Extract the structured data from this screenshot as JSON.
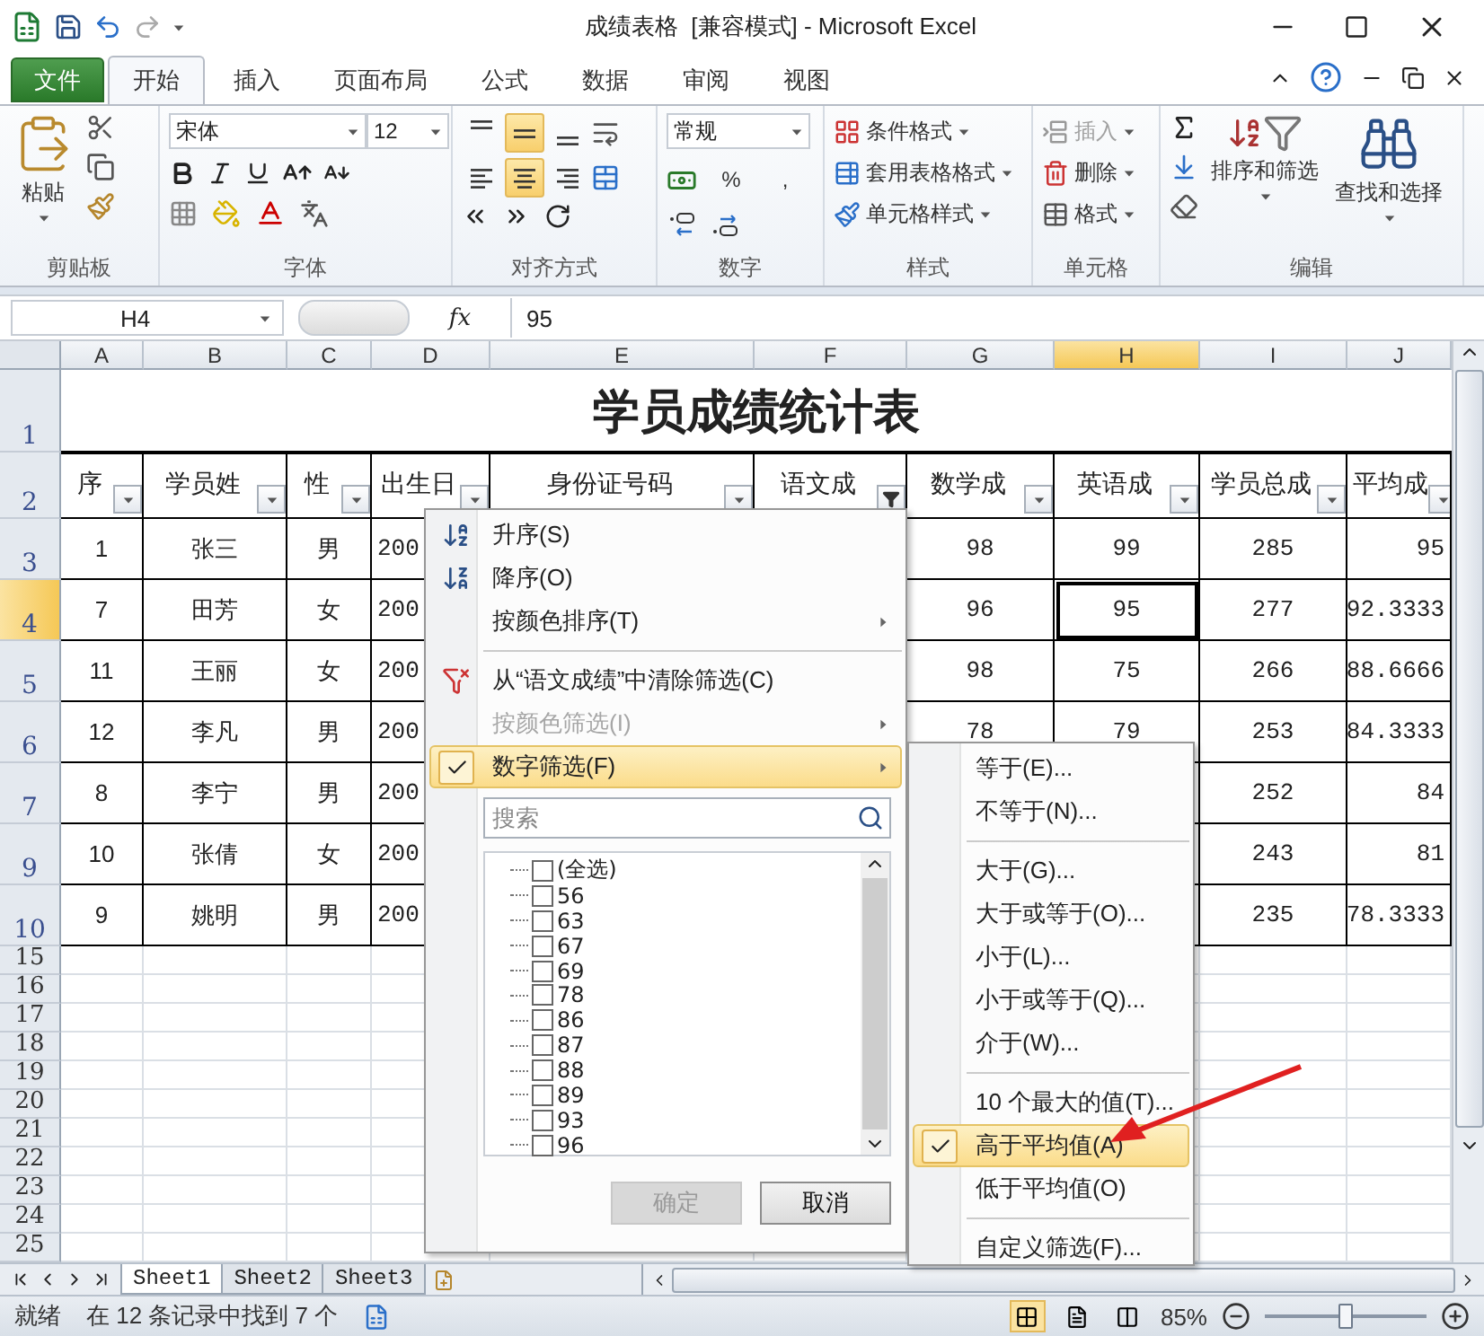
{
  "window": {
    "title": "成绩表格  [兼容模式] - Microsoft Excel"
  },
  "ribbon_tabs": [
    {
      "label": "文件",
      "kind": "file",
      "selected": false
    },
    {
      "label": "开始",
      "kind": "tab",
      "selected": true
    },
    {
      "label": "插入",
      "kind": "tab",
      "selected": false
    },
    {
      "label": "页面布局",
      "kind": "tab",
      "selected": false
    },
    {
      "label": "公式",
      "kind": "tab",
      "selected": false
    },
    {
      "label": "数据",
      "kind": "tab",
      "selected": false
    },
    {
      "label": "审阅",
      "kind": "tab",
      "selected": false
    },
    {
      "label": "视图",
      "kind": "tab",
      "selected": false
    }
  ],
  "ribbon": {
    "paste": "粘贴",
    "font_name": "宋体",
    "font_size": "12",
    "alignment_buttons": [
      {
        "kind": "top",
        "selected": false
      },
      {
        "kind": "middle",
        "selected": true
      },
      {
        "kind": "bottom",
        "selected": false
      },
      {
        "kind": "left",
        "selected": false
      },
      {
        "kind": "center",
        "selected": true
      },
      {
        "kind": "right",
        "selected": false
      }
    ],
    "number_format": "常规",
    "percent": "%",
    "comma": ",",
    "styles": [
      "条件格式",
      "套用表格格式",
      "单元格样式"
    ],
    "cells": [
      {
        "label": "插入",
        "disabled": true
      },
      {
        "label": "删除",
        "disabled": false
      },
      {
        "label": "格式",
        "disabled": false
      }
    ],
    "sort_filter": "排序和筛选",
    "find_select": "查找和选择",
    "groups": [
      "剪贴板",
      "字体",
      "对齐方式",
      "数字",
      "样式",
      "单元格",
      "编辑"
    ]
  },
  "formula_bar": {
    "name_box": "H4",
    "fx": "fx",
    "value": "95"
  },
  "sheet": {
    "columns": [
      {
        "label": "A",
        "selected": false
      },
      {
        "label": "B",
        "selected": false
      },
      {
        "label": "C",
        "selected": false
      },
      {
        "label": "D",
        "selected": false
      },
      {
        "label": "E",
        "selected": false
      },
      {
        "label": "F",
        "selected": false
      },
      {
        "label": "G",
        "selected": false
      },
      {
        "label": "H",
        "selected": true
      },
      {
        "label": "I",
        "selected": false
      },
      {
        "label": "J",
        "selected": false
      }
    ],
    "title_row": "1",
    "title": "学员成绩统计表",
    "header_row": "2",
    "headers": [
      {
        "text": "序",
        "filtered": false
      },
      {
        "text": "学员姓",
        "filtered": false
      },
      {
        "text": "性",
        "filtered": false
      },
      {
        "text": "出生日",
        "filtered": false
      },
      {
        "text": "身份证号码",
        "filtered": false
      },
      {
        "text": "语文成",
        "filtered": true
      },
      {
        "text": "数学成",
        "filtered": false
      },
      {
        "text": "英语成",
        "filtered": false
      },
      {
        "text": "学员总成",
        "filtered": false
      },
      {
        "text": "平均成",
        "filtered": false
      }
    ],
    "rows": [
      {
        "header": "3",
        "selected": false,
        "a": "1",
        "b": "张三",
        "c": "男",
        "d": "200",
        "g": "98",
        "h": "99",
        "i": "285",
        "j": "95"
      },
      {
        "header": "4",
        "selected": true,
        "a": "7",
        "b": "田芳",
        "c": "女",
        "d": "200",
        "g": "96",
        "h": "95",
        "i": "277",
        "j": "92.3333"
      },
      {
        "header": "5",
        "selected": false,
        "a": "11",
        "b": "王丽",
        "c": "女",
        "d": "200",
        "g": "98",
        "h": "75",
        "i": "266",
        "j": "88.6666"
      },
      {
        "header": "6",
        "selected": false,
        "a": "12",
        "b": "李凡",
        "c": "男",
        "d": "200",
        "g": "78",
        "h": "79",
        "i": "253",
        "j": "84.3333"
      },
      {
        "header": "7",
        "selected": false,
        "a": "8",
        "b": "李宁",
        "c": "男",
        "d": "200",
        "i": "252",
        "j": "84"
      },
      {
        "header": "9",
        "selected": false,
        "a": "10",
        "b": "张倩",
        "c": "女",
        "d": "200",
        "i": "243",
        "j": "81"
      },
      {
        "header": "10",
        "selected": false,
        "a": "9",
        "b": "姚明",
        "c": "男",
        "d": "200",
        "i": "235",
        "j": "78.3333"
      }
    ],
    "empty_rows": [
      "15",
      "16",
      "17",
      "18",
      "19",
      "20",
      "21",
      "22",
      "23",
      "24",
      "25"
    ]
  },
  "filter_menu": {
    "items": [
      {
        "kind": "item",
        "label": "升序(S)",
        "disabled": false,
        "checked": false,
        "selected": false,
        "submenu": false
      },
      {
        "kind": "item",
        "label": "降序(O)",
        "disabled": false,
        "checked": false,
        "selected": false,
        "submenu": false
      },
      {
        "kind": "item",
        "label": "按颜色排序(T)",
        "disabled": false,
        "checked": false,
        "selected": false,
        "submenu": true
      },
      {
        "kind": "separator"
      },
      {
        "kind": "item",
        "label": "从“语文成绩”中清除筛选(C)",
        "disabled": false,
        "checked": false,
        "selected": false,
        "submenu": false
      },
      {
        "kind": "item",
        "label": "按颜色筛选(I)",
        "disabled": true,
        "checked": false,
        "selected": false,
        "submenu": true
      },
      {
        "kind": "item",
        "label": "数字筛选(F)",
        "disabled": false,
        "checked": true,
        "selected": true,
        "submenu": true
      }
    ],
    "search": {
      "placeholder": "搜索"
    },
    "values": [
      {
        "label": "(全选)",
        "checked": false
      },
      {
        "label": "56",
        "checked": false
      },
      {
        "label": "63",
        "checked": false
      },
      {
        "label": "67",
        "checked": false
      },
      {
        "label": "69",
        "checked": false
      },
      {
        "label": "78",
        "checked": false
      },
      {
        "label": "86",
        "checked": false
      },
      {
        "label": "87",
        "checked": false
      },
      {
        "label": "88",
        "checked": false
      },
      {
        "label": "89",
        "checked": false
      },
      {
        "label": "93",
        "checked": false
      },
      {
        "label": "96",
        "checked": false
      }
    ],
    "buttons": [
      {
        "label": "确定",
        "disabled": true
      },
      {
        "label": "取消",
        "disabled": false
      }
    ]
  },
  "number_filter_menu": {
    "items": [
      {
        "kind": "item",
        "label": "等于(E)...",
        "checked": false,
        "selected": false
      },
      {
        "kind": "item",
        "label": "不等于(N)...",
        "checked": false,
        "selected": false
      },
      {
        "kind": "separator"
      },
      {
        "kind": "item",
        "label": "大于(G)...",
        "checked": false,
        "selected": false
      },
      {
        "kind": "item",
        "label": "大于或等于(O)...",
        "checked": false,
        "selected": false
      },
      {
        "kind": "item",
        "label": "小于(L)...",
        "checked": false,
        "selected": false
      },
      {
        "kind": "item",
        "label": "小于或等于(Q)...",
        "checked": false,
        "selected": false
      },
      {
        "kind": "item",
        "label": "介于(W)...",
        "checked": false,
        "selected": false
      },
      {
        "kind": "separator"
      },
      {
        "kind": "item",
        "label": "10 个最大的值(T)...",
        "checked": false,
        "selected": false
      },
      {
        "kind": "item",
        "label": "高于平均值(A)",
        "checked": true,
        "selected": true
      },
      {
        "kind": "item",
        "label": "低于平均值(O)",
        "checked": false,
        "selected": false
      },
      {
        "kind": "separator"
      },
      {
        "kind": "item",
        "label": "自定义筛选(F)...",
        "checked": false,
        "selected": false
      }
    ]
  },
  "sheet_tabs": [
    {
      "label": "Sheet1",
      "selected": true
    },
    {
      "label": "Sheet2",
      "selected": false
    },
    {
      "label": "Sheet3",
      "selected": false
    }
  ],
  "status_bar": {
    "ready": "就绪",
    "message": "在 12 条记录中找到 7 个",
    "zoom": "85%",
    "zoom_level": {
      "level": 0.5
    }
  }
}
